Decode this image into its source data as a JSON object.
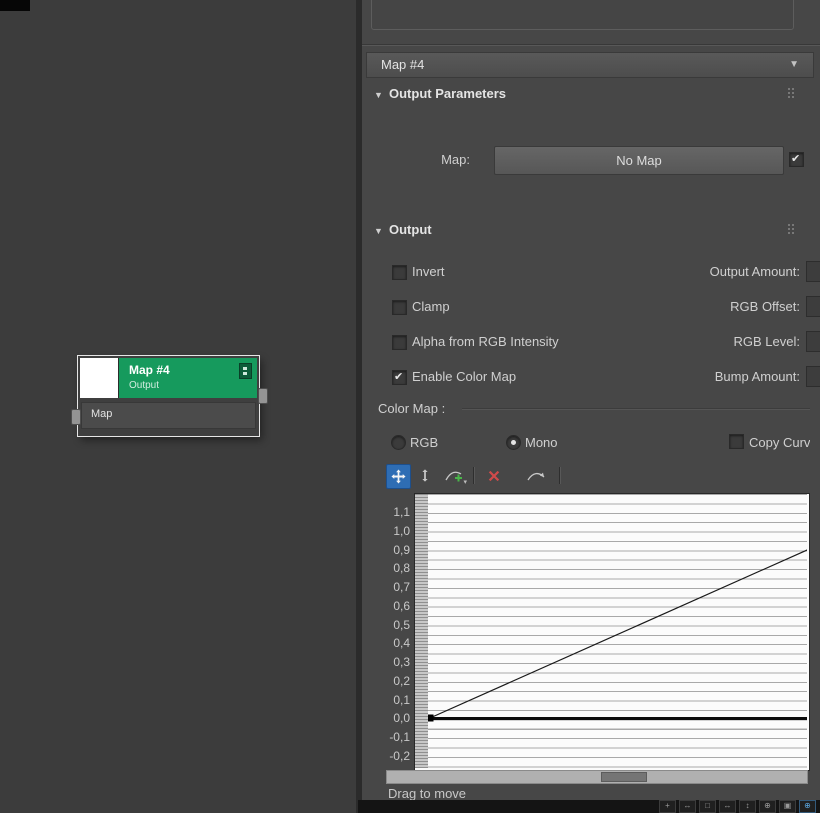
{
  "colors": {
    "node_green": "#169a5d",
    "toolbar_active_blue": "#2e6db4",
    "delete_red": "#cf4a4a",
    "add_green": "#49b549"
  },
  "node_editor": {
    "node": {
      "title": "Map #4",
      "subtitle": "Output",
      "slot": "Map"
    }
  },
  "panel": {
    "selector": {
      "value": "Map #4"
    },
    "output_parameters": {
      "title": "Output Parameters",
      "map_label": "Map:",
      "map_button": "No Map",
      "map_enabled": true
    },
    "output": {
      "title": "Output",
      "checkboxes": [
        {
          "label": "Invert",
          "checked": false
        },
        {
          "label": "Clamp",
          "checked": false
        },
        {
          "label": "Alpha from RGB Intensity",
          "checked": false
        },
        {
          "label": "Enable Color Map",
          "checked": true
        }
      ],
      "spinners": [
        {
          "label": "Output Amount:"
        },
        {
          "label": "RGB Offset:"
        },
        {
          "label": "RGB Level:"
        },
        {
          "label": "Bump Amount:"
        }
      ],
      "color_map": {
        "label": "Color Map :",
        "rgb": "RGB",
        "rgb_selected": false,
        "mono": "Mono",
        "mono_selected": true,
        "copy": "Copy Curv"
      }
    },
    "curve_editor": {
      "y_axis_labels": [
        "1,1",
        "1,0",
        "0,9",
        "0,8",
        "0,7",
        "0,6",
        "0,5",
        "0,4",
        "0,3",
        "0,2",
        "0,1",
        "0,0",
        "-0,1",
        "-0,2"
      ],
      "curve_points": [
        [
          0,
          0
        ],
        [
          1,
          1
        ]
      ],
      "hint": "Drag to move",
      "footer_icons": [
        {
          "name": "pan-icon",
          "glyph": "+"
        },
        {
          "name": "zoom-extents-horizontal-icon",
          "glyph": "↔"
        },
        {
          "name": "zoom-extents-icon",
          "glyph": "□"
        },
        {
          "name": "zoom-horizontal-icon",
          "glyph": "↔"
        },
        {
          "name": "zoom-vertical-icon",
          "glyph": "↕"
        },
        {
          "name": "zoom-icon",
          "glyph": "⊕"
        },
        {
          "name": "zoom-region-icon",
          "glyph": "▣"
        },
        {
          "name": "zoom-curve-icon",
          "glyph": "⊕"
        }
      ]
    }
  }
}
